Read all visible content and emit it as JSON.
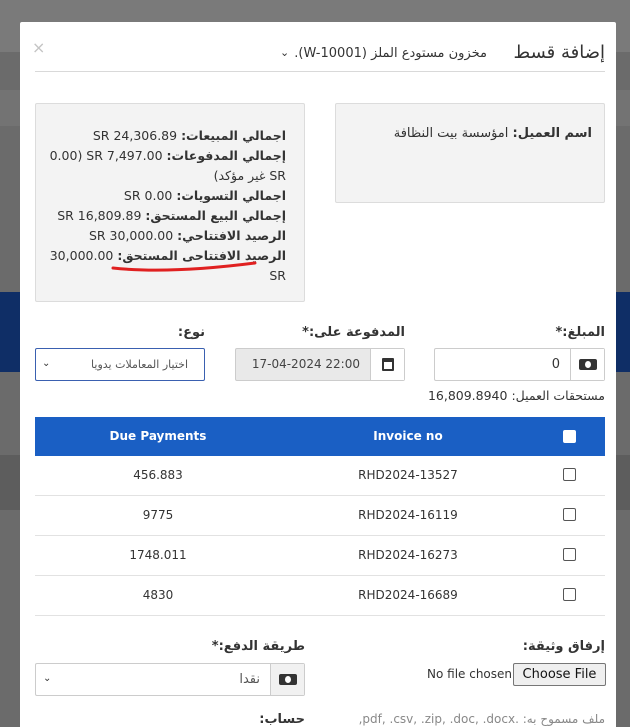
{
  "modal": {
    "title": "إضافة قسط",
    "close": "×",
    "warehouse": "مخزون مستودع الملز (W-10001)."
  },
  "customer": {
    "label": "اسم العميل:",
    "value": "امؤسسة بيت النظافة"
  },
  "summary": [
    {
      "label": "اجمالي المبيعات:",
      "value": "SR 24,306.89"
    },
    {
      "label": "إجمالي المدفوعات:",
      "value": "SR 7,497.00 (0.00 SR غير مؤكد)"
    },
    {
      "label": "اجمالي التسويات:",
      "value": "SR 0.00"
    },
    {
      "label": "إجمالي البيع المستحق:",
      "value": "SR 16,809.89"
    },
    {
      "label": "الرصيد الافتتاحي:",
      "value": "SR 30,000.00"
    },
    {
      "label": "الرصيد الافتتاحى المستحق:",
      "value": "30,000.00 SR"
    }
  ],
  "form": {
    "amount_label": "المبلغ:*",
    "amount_value": "0",
    "paid_on_label": "المدفوعة على:*",
    "paid_on_value": "17-04-2024 22:00",
    "type_label": "نوع:",
    "type_value": "اختيار المعاملات يدويا",
    "dues_line": "مستحقات العميل: 16,809.8940"
  },
  "table": {
    "headers": {
      "due": "Due Payments",
      "invoice": "Invoice no"
    },
    "rows": [
      {
        "due": "456.883",
        "invoice": "RHD2024-13527"
      },
      {
        "due": "9775",
        "invoice": "RHD2024-16119"
      },
      {
        "due": "1748.011",
        "invoice": "RHD2024-16273"
      },
      {
        "due": "4830",
        "invoice": "RHD2024-16689"
      }
    ]
  },
  "attach": {
    "label": "إرفاق وثيقة:",
    "button": "Choose File",
    "status": "No file chosen",
    "allowed": "ملف مسموح به: .pdf, .csv, .zip, .doc, .docx,"
  },
  "payment": {
    "method_label": "طريقة الدفع:*",
    "method_value": "نقدا",
    "account_label": "حساب:"
  },
  "colors": {
    "table_header": "#1a5fc4",
    "underline": "#e02020"
  }
}
